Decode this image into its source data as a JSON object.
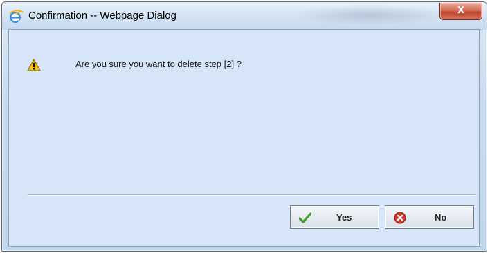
{
  "window": {
    "title": "Confirmation -- Webpage Dialog",
    "app_icon": "internet-explorer-icon",
    "close_label": "X"
  },
  "dialog": {
    "icon": "warning-icon",
    "message": "Are you sure you want to delete step [2] ?"
  },
  "buttons": {
    "yes_label": "Yes",
    "yes_icon": "checkmark-icon",
    "no_label": "No",
    "no_icon": "cancel-circle-icon"
  },
  "colors": {
    "content_background": "#d6e5f7",
    "close_button": "#c0452f",
    "checkmark": "#3f9e2a",
    "cancel": "#d03a2c",
    "warning": "#f2c21b"
  }
}
